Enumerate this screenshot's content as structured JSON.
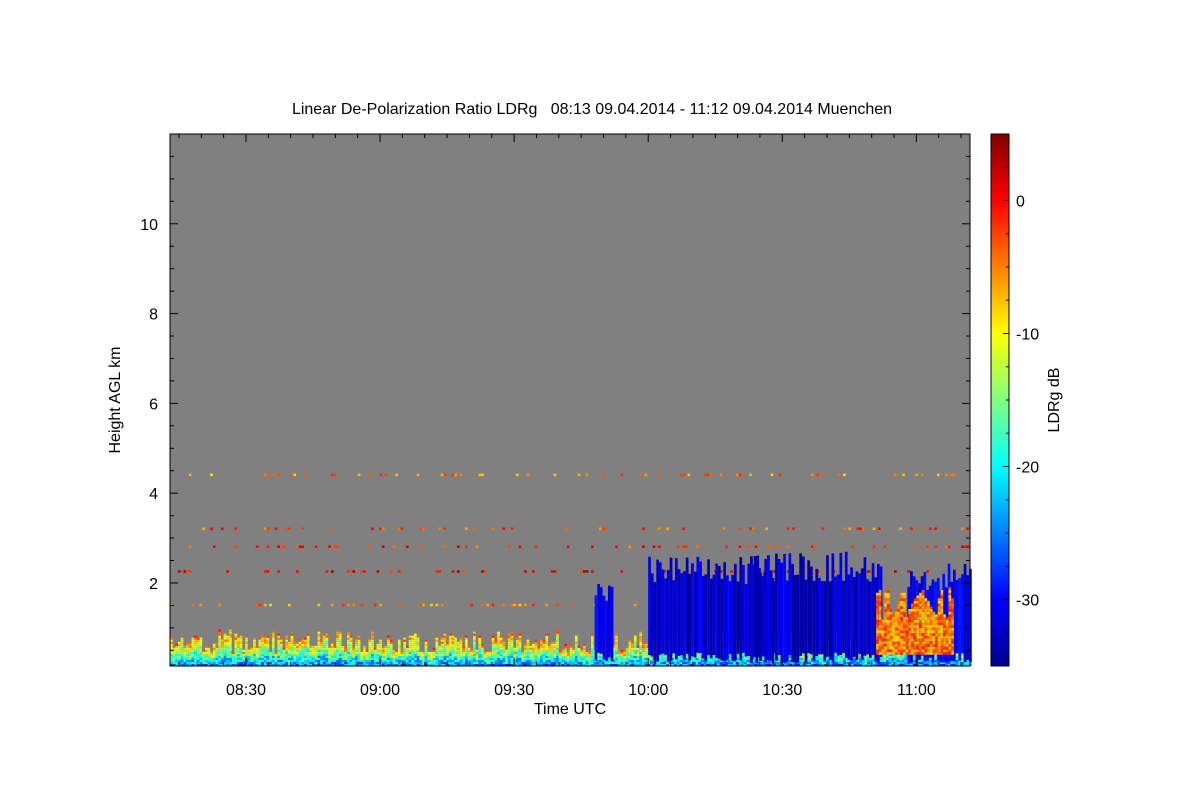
{
  "chart_data": {
    "type": "heatmap",
    "title": "Linear De-Polarization Ratio LDRg   08:13 09.04.2014 - 11:12 09.04.2014 Muenchen",
    "xlabel": "Time UTC",
    "ylabel": "Height AGL km",
    "xlim": [
      "08:13",
      "11:12"
    ],
    "x_ticks": [
      "08:30",
      "09:00",
      "09:30",
      "10:00",
      "10:30",
      "11:00"
    ],
    "ylim": [
      0.15,
      12.0
    ],
    "y_ticks": [
      "2",
      "4",
      "6",
      "8",
      "10"
    ],
    "colorbar": {
      "label": "LDRg dB",
      "range": [
        -35,
        5
      ],
      "ticks": [
        "0",
        "-10",
        "-20",
        "-30"
      ],
      "colormap": "jet"
    },
    "background_color": "#808080",
    "features": [
      {
        "kind": "boundary layer",
        "time_start": "08:13",
        "time_end": "11:12",
        "height_top_km": 0.8,
        "ldr_db": [
          -25,
          -5
        ]
      },
      {
        "kind": "sparse speckle layer",
        "height_km": 4.4,
        "ldr_db": -5
      },
      {
        "kind": "sparse speckle layer",
        "height_km": 3.2,
        "ldr_db": -3
      },
      {
        "kind": "sparse speckle layer",
        "height_km": 2.8,
        "ldr_db": -2
      },
      {
        "kind": "sparse speckle layer",
        "height_km": 2.25,
        "ldr_db": 0
      },
      {
        "kind": "sparse speckle layer",
        "height_km": 1.5,
        "ldr_db": -5
      },
      {
        "kind": "low-LDR echo",
        "time_start": "09:48",
        "time_end": "09:52",
        "height_top_km": 2.1,
        "ldr_db": -31
      },
      {
        "kind": "low-LDR echo",
        "time_start": "10:00",
        "time_end": "10:28",
        "height_top_km": 2.6,
        "ldr_db": -32
      },
      {
        "kind": "low-LDR echo",
        "time_start": "10:23",
        "time_end": "10:52",
        "height_top_km": 2.7,
        "ldr_db": -32
      },
      {
        "kind": "low-LDR echo",
        "time_start": "10:58",
        "time_end": "11:12",
        "height_top_km": 2.45,
        "ldr_db": -31
      },
      {
        "kind": "high-LDR region",
        "time_start": "10:51",
        "time_end": "11:08",
        "height_top_km": 1.9,
        "ldr_db": -5
      }
    ]
  }
}
